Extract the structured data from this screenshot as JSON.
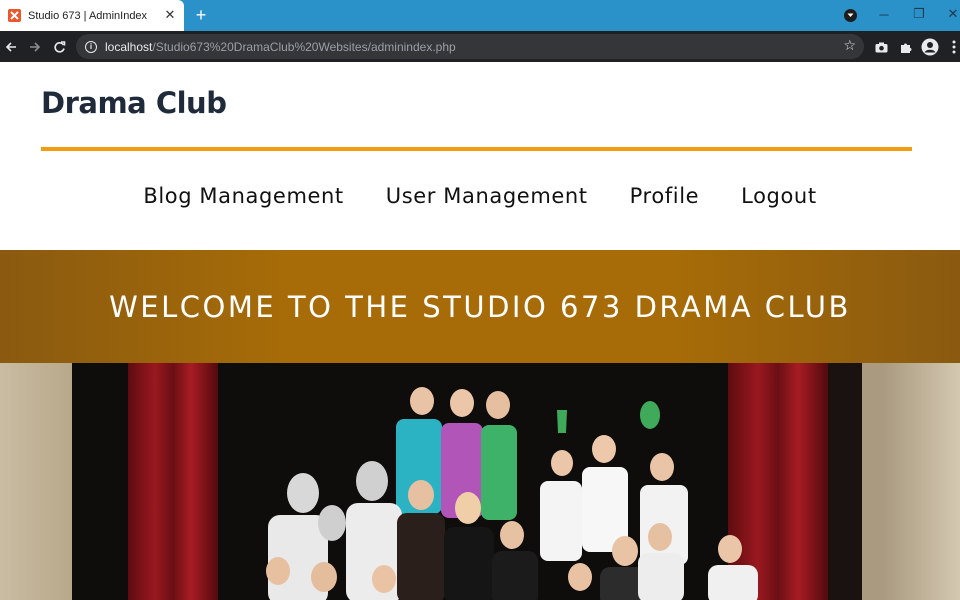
{
  "browser": {
    "tab": {
      "title": "Studio 673 | AdminIndex",
      "favicon": "xampp-icon",
      "close_label": "✕"
    },
    "new_tab_label": "+",
    "url": {
      "host": "localhost",
      "path": "/Studio673%20DramaClub%20Websites/adminindex.php"
    },
    "window_controls": {
      "minimize": "─",
      "restore": "❐",
      "close": "✕"
    },
    "colors": {
      "tabbar": "#2b91c9",
      "toolbar": "#202124"
    }
  },
  "site": {
    "title": "Drama Club",
    "accent": "#f39c12",
    "menu": [
      {
        "label": "Blog Management"
      },
      {
        "label": "User Management"
      },
      {
        "label": "Profile"
      },
      {
        "label": "Logout"
      }
    ]
  },
  "hero": {
    "banner_text": "WELCOME TO THE STUDIO 673 DRAMA CLUB",
    "banner_color": "#a76c08"
  }
}
